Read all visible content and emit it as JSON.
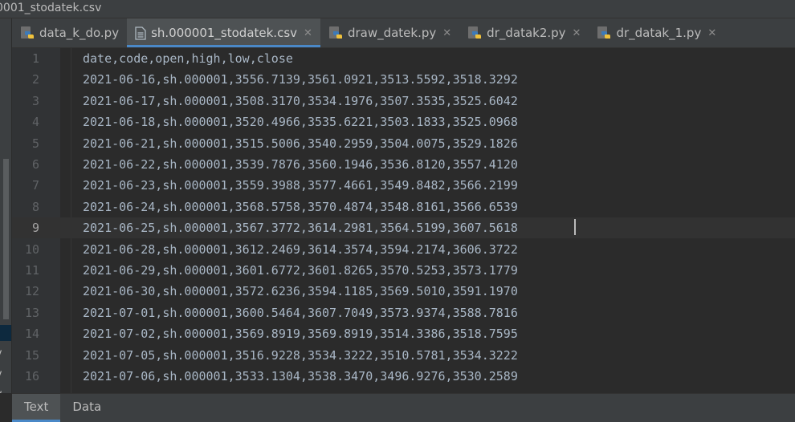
{
  "window": {
    "title": "0001_stodatek.csv"
  },
  "left_panel": {
    "fragments": [
      "v",
      "sv",
      "sv",
      "sv"
    ]
  },
  "tabs": [
    {
      "label": "data_k_do.py",
      "icon": "python-file-icon",
      "active": false,
      "closable": false
    },
    {
      "label": "sh.000001_stodatek.csv",
      "icon": "csv-file-icon",
      "active": true,
      "closable": true
    },
    {
      "label": "draw_datek.py",
      "icon": "python-file-icon",
      "active": false,
      "closable": true
    },
    {
      "label": "dr_datak2.py",
      "icon": "python-file-icon",
      "active": false,
      "closable": true
    },
    {
      "label": "dr_datak_1.py",
      "icon": "python-file-icon",
      "active": false,
      "closable": true
    }
  ],
  "editor": {
    "current_line": 9,
    "lines": [
      {
        "num": "1",
        "text": "date,code,open,high,low,close"
      },
      {
        "num": "2",
        "text": "2021-06-16,sh.000001,3556.7139,3561.0921,3513.5592,3518.3292"
      },
      {
        "num": "3",
        "text": "2021-06-17,sh.000001,3508.3170,3534.1976,3507.3535,3525.6042"
      },
      {
        "num": "4",
        "text": "2021-06-18,sh.000001,3520.4966,3535.6221,3503.1833,3525.0968"
      },
      {
        "num": "5",
        "text": "2021-06-21,sh.000001,3515.5006,3540.2959,3504.0075,3529.1826"
      },
      {
        "num": "6",
        "text": "2021-06-22,sh.000001,3539.7876,3560.1946,3536.8120,3557.4120"
      },
      {
        "num": "7",
        "text": "2021-06-23,sh.000001,3559.3988,3577.4661,3549.8482,3566.2199"
      },
      {
        "num": "8",
        "text": "2021-06-24,sh.000001,3568.5758,3570.4874,3548.8161,3566.6539"
      },
      {
        "num": "9",
        "text": "2021-06-25,sh.000001,3567.3772,3614.2981,3564.5199,3607.5618"
      },
      {
        "num": "10",
        "text": "2021-06-28,sh.000001,3612.2469,3614.3574,3594.2174,3606.3722"
      },
      {
        "num": "11",
        "text": "2021-06-29,sh.000001,3601.6772,3601.8265,3570.5253,3573.1779"
      },
      {
        "num": "12",
        "text": "2021-06-30,sh.000001,3572.6236,3594.1185,3569.5010,3591.1970"
      },
      {
        "num": "13",
        "text": "2021-07-01,sh.000001,3600.5464,3607.7049,3573.9374,3588.7816"
      },
      {
        "num": "14",
        "text": "2021-07-02,sh.000001,3569.8919,3569.8919,3514.3386,3518.7595"
      },
      {
        "num": "15",
        "text": "2021-07-05,sh.000001,3516.9228,3534.3222,3510.5781,3534.3222"
      },
      {
        "num": "16",
        "text": "2021-07-06,sh.000001,3533.1304,3538.3470,3496.9276,3530.2589"
      }
    ]
  },
  "bottom_tabs": [
    {
      "label": "Text",
      "active": true
    },
    {
      "label": "Data",
      "active": false
    }
  ],
  "colors": {
    "background": "#2b2b2b",
    "panel": "#3c3f41",
    "accent": "#4a88c7",
    "text": "#a9b7c6",
    "line_number": "#606366"
  }
}
